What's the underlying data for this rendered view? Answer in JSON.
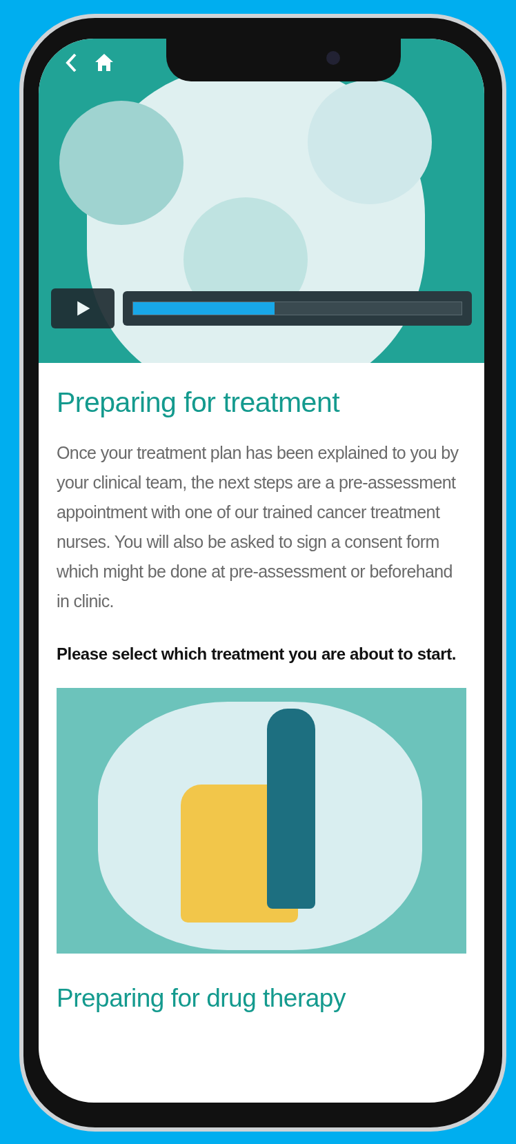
{
  "video": {
    "progress": {
      "level": 0.43
    }
  },
  "title": "Preparing for treatment",
  "intro": "Once your treatment plan has been explained to you by your clinical team, the next steps are a pre-assessment appointment with one of our trained cancer treatment nurses. You will also be asked to sign a consent form which might be done at pre-assessment or beforehand  in clinic.",
  "prompt": "Please select which treatment you are about to start.",
  "next_heading": "Preparing for drug therapy"
}
